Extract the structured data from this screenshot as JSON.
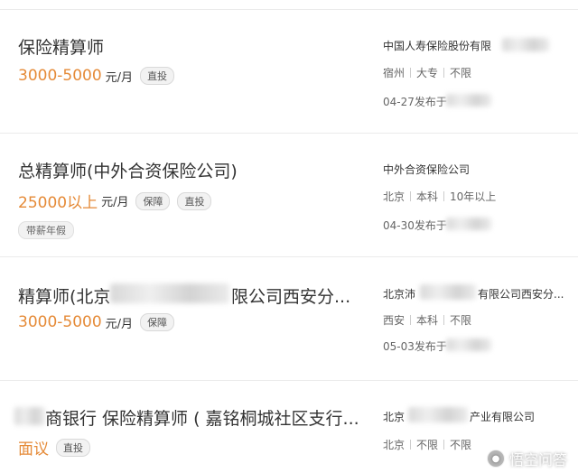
{
  "jobs": [
    {
      "title": "保险精算师",
      "salary": "3000-5000",
      "unit": "元/月",
      "tags": [
        "直投"
      ],
      "welfare": [],
      "company": "中国人寿保险股份有限",
      "meta": [
        "宿州",
        "大专",
        "不限"
      ],
      "posted": "04-27发布于"
    },
    {
      "title": "总精算师(中外合资保险公司)",
      "salary": "25000以上",
      "unit": "元/月",
      "tags": [
        "保障",
        "直投"
      ],
      "welfare": [
        "带薪年假"
      ],
      "company": "中外合资保险公司",
      "meta": [
        "北京",
        "本科",
        "10年以上"
      ],
      "posted": "04-30发布于"
    },
    {
      "title_left": "精算师(北京",
      "title_right": "限公司西安分...",
      "salary": "3000-5000",
      "unit": "元/月",
      "tags": [
        "保障"
      ],
      "welfare": [],
      "company_left": "北京沛",
      "company_right": "有限公司西安分...",
      "meta": [
        "西安",
        "本科",
        "不限"
      ],
      "posted": "05-03发布于"
    },
    {
      "title": "商银行 保险精算师 ( 嘉铭桐城社区支行...",
      "salary": "面议",
      "unit": "",
      "tags": [
        "直投"
      ],
      "welfare": [],
      "company_left": "北京",
      "company_right": "产业有限公司",
      "meta": [
        "北京",
        "不限",
        "不限"
      ],
      "posted": ""
    }
  ],
  "watermark": {
    "text": "悟空问答",
    "icon": "wukong-logo-icon"
  }
}
